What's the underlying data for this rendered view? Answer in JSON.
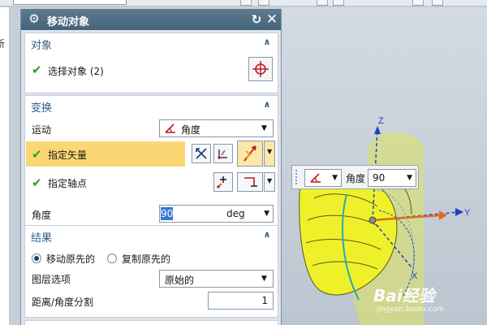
{
  "dialog": {
    "title": "移动对象",
    "groups": {
      "object": {
        "header": "对象",
        "select_label": "选择对象 (2)"
      },
      "transform": {
        "header": "变换",
        "motion_label": "运动",
        "motion_value": "角度",
        "vector_label": "指定矢量",
        "axis_point_label": "指定轴点",
        "angle_label": "角度",
        "angle_value": "90",
        "angle_unit": "deg"
      },
      "result": {
        "header": "结果",
        "move_original_label": "移动原先的",
        "copy_original_label": "复制原先的",
        "move_original_selected": true,
        "layer_option_label": "图层选项",
        "layer_option_value": "原始的",
        "distance_angle_split_label": "距离/角度分割",
        "distance_angle_split_value": "1"
      }
    }
  },
  "left_panel": {
    "label": "新"
  },
  "floating_toolbar": {
    "angle_label": "角度",
    "angle_value": "90"
  },
  "viewport": {
    "axes": {
      "x": "X",
      "y": "Y",
      "z": "Z"
    },
    "vector_color": "#e36b1f",
    "axis_color": "#1f3fc8",
    "model_color": "#eef12a"
  },
  "watermark": {
    "text": "Bai经验",
    "subtext": "jingyan.baidu.com"
  }
}
